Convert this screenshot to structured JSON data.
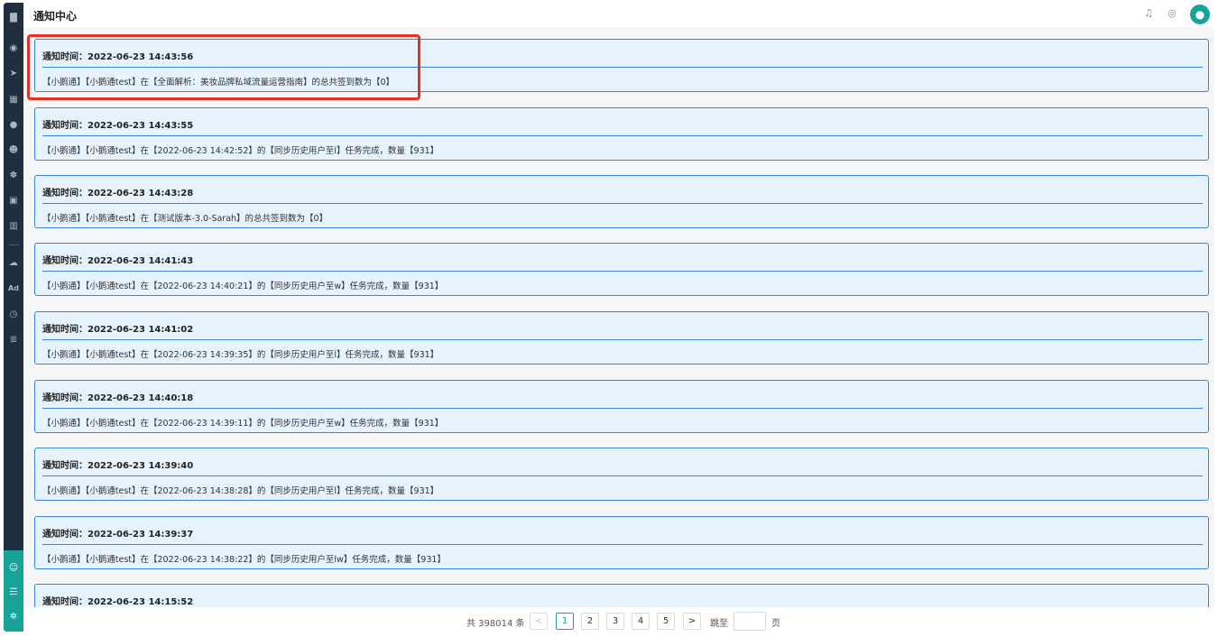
{
  "header": {
    "title": "通知中心",
    "icons": [
      "bell-icon",
      "chat-icon",
      "user-avatar-icon"
    ]
  },
  "sidebar": {
    "icons": [
      "dashboard-icon",
      "send-icon",
      "table-icon",
      "user-icon",
      "users-icon",
      "group-icon",
      "bookmark-icon",
      "chart-icon",
      "wechat-icon",
      "ad-icon",
      "clock-icon",
      "document-icon"
    ],
    "ad_label": "Ad",
    "bottom_icons": [
      "customer-service-icon",
      "menu-icon",
      "settings-icon"
    ]
  },
  "notifications": [
    {
      "time": "通知时间：2022-06-23 14:43:56",
      "message": "【小鹅通】【小鹅通test】在【全面解析：美妆品牌私域流量运营指南】的总共签到数为【0】"
    },
    {
      "time": "通知时间：2022-06-23 14:43:55",
      "message": "【小鹅通】【小鹅通test】在【2022-06-23 14:42:52】的【同步历史用户至l】任务完成，数量【931】"
    },
    {
      "time": "通知时间：2022-06-23 14:43:28",
      "message": "【小鹅通】【小鹅通test】在【测试版本-3.0-Sarah】的总共签到数为【0】"
    },
    {
      "time": "通知时间：2022-06-23 14:41:43",
      "message": "【小鹅通】【小鹅通test】在【2022-06-23 14:40:21】的【同步历史用户至w】任务完成，数量【931】"
    },
    {
      "time": "通知时间：2022-06-23 14:41:02",
      "message": "【小鹅通】【小鹅通test】在【2022-06-23 14:39:35】的【同步历史用户至l】任务完成，数量【931】"
    },
    {
      "time": "通知时间：2022-06-23 14:40:18",
      "message": "【小鹅通】【小鹅通test】在【2022-06-23 14:39:11】的【同步历史用户至w】任务完成，数量【931】"
    },
    {
      "time": "通知时间：2022-06-23 14:39:40",
      "message": "【小鹅通】【小鹅通test】在【2022-06-23 14:38:28】的【同步历史用户至l】任务完成，数量【931】"
    },
    {
      "time": "通知时间：2022-06-23 14:39:37",
      "message": "【小鹅通】【小鹅通test】在【2022-06-23 14:38:22】的【同步历史用户至lw】任务完成，数量【931】"
    },
    {
      "time": "通知时间：2022-06-23 14:15:52",
      "message": ""
    }
  ],
  "pagination": {
    "total_text": "共 398014 条",
    "prev": "<",
    "pages": [
      "1",
      "2",
      "3",
      "4",
      "5"
    ],
    "active_page": "1",
    "next": ">",
    "jump_label": "跳至",
    "jump_value": "",
    "page_unit": "页"
  },
  "colors": {
    "accent": "#17a398",
    "card_border": "#3d83d9",
    "card_bg": "#e6f2fc",
    "highlight": "#e53228",
    "sidebar_bg": "#1f2f3f"
  }
}
